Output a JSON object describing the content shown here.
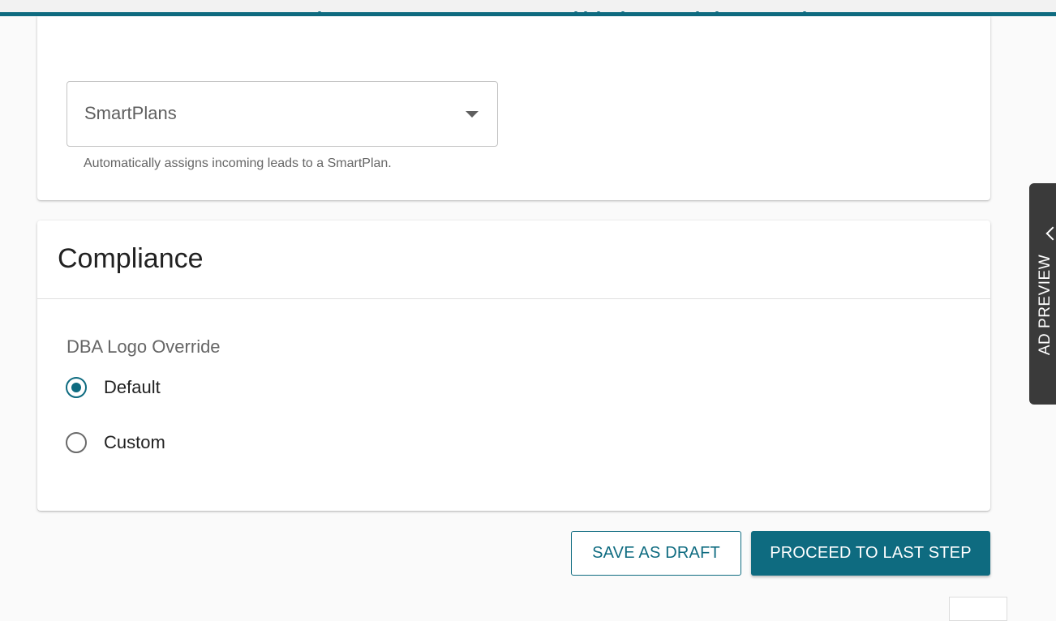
{
  "theme": {
    "accent": "#0e6b80",
    "background": "#fafafa",
    "card": "#ffffff"
  },
  "smartplan": {
    "select_value": "SmartPlans",
    "helper_text": "Automatically assigns incoming leads to a SmartPlan.",
    "arrow_icon": "caret-down-icon"
  },
  "compliance": {
    "title": "Compliance",
    "field_label": "DBA Logo Override",
    "options": [
      {
        "label": "Default",
        "checked": true
      },
      {
        "label": "Custom",
        "checked": false
      }
    ]
  },
  "actions": {
    "save_draft": "SAVE AS DRAFT",
    "proceed": "PROCEED TO LAST STEP"
  },
  "ad_preview": {
    "label": "AD PREVIEW",
    "icon": "chevron-up-icon"
  }
}
